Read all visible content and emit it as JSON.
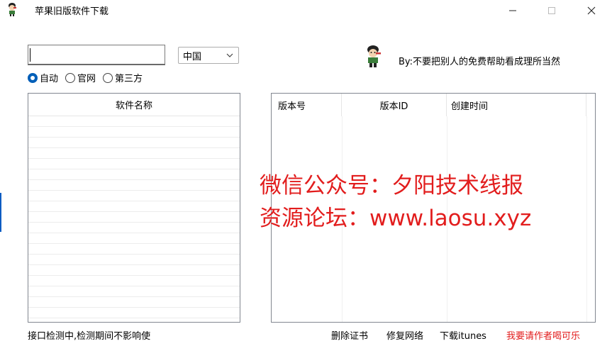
{
  "window": {
    "title": "苹果旧版软件下载",
    "icon": "cartoon-boy-icon",
    "controls": {
      "minimize": "minimize-icon",
      "maximize": "maximize-icon",
      "close": "close-icon"
    }
  },
  "search": {
    "value": "",
    "placeholder": ""
  },
  "region": {
    "selected": "中国",
    "icon": "chevron-down-icon"
  },
  "source_options": [
    {
      "label": "自动",
      "checked": true
    },
    {
      "label": "官网",
      "checked": false
    },
    {
      "label": "第三方",
      "checked": false
    }
  ],
  "author": {
    "text": "By:不要把别人的免费帮助看成理所当然",
    "icon": "cartoon-boy-icon"
  },
  "software_list": {
    "header": "软件名称",
    "rows": []
  },
  "version_table": {
    "columns": [
      "版本号",
      "版本ID",
      "创建时间"
    ],
    "rows": []
  },
  "watermark": {
    "line1": "微信公众号：夕阳技术线报",
    "line2": "资源论坛：www.laosu.xyz",
    "color": "#e21d1d"
  },
  "status": "接口检测中,检测期间不影响使",
  "actions": {
    "delete_cert": "删除证书",
    "repair_network": "修复网络",
    "download_itunes": "下载itunes",
    "donate": "我要请作者喝可乐"
  },
  "colors": {
    "accent": "#005fb8",
    "donate": "#e21d1d"
  }
}
